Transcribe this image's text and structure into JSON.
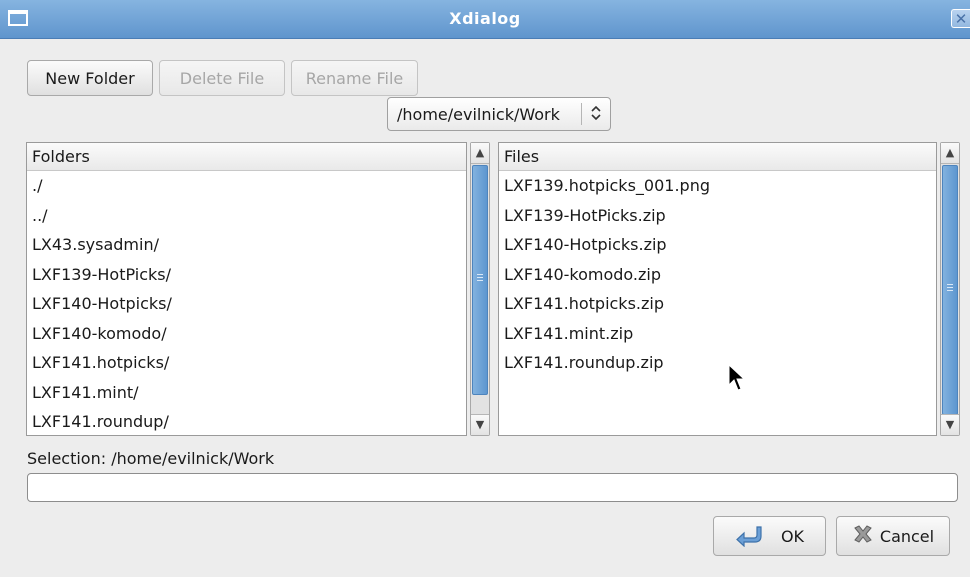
{
  "window": {
    "title": "Xdialog"
  },
  "toolbar": {
    "new_folder": "New Folder",
    "delete_file": "Delete File",
    "rename_file": "Rename File"
  },
  "path_combo": {
    "value": "/home/evilnick/Work"
  },
  "folders": {
    "header": "Folders",
    "items": [
      "./",
      "../",
      "LX43.sysadmin/",
      "LXF139-HotPicks/",
      "LXF140-Hotpicks/",
      "LXF140-komodo/",
      "LXF141.hotpicks/",
      "LXF141.mint/",
      "LXF141.roundup/"
    ]
  },
  "files": {
    "header": "Files",
    "items": [
      "LXF139.hotpicks_001.png",
      "LXF139-HotPicks.zip",
      "LXF140-Hotpicks.zip",
      "LXF140-komodo.zip",
      "LXF141.hotpicks.zip",
      "LXF141.mint.zip",
      "LXF141.roundup.zip"
    ]
  },
  "selection": {
    "label": "Selection: /home/evilnick/Work",
    "value": ""
  },
  "buttons": {
    "ok": "OK",
    "cancel": "Cancel"
  },
  "icons": {
    "window": "window-icon",
    "close": "close-icon",
    "combo": "chevron-up-down-icon",
    "ok": "return-arrow-icon",
    "cancel": "cross-icon"
  },
  "colors": {
    "titlebar": "#6fa2d7",
    "scroll_thumb": "#6fa2d7",
    "background": "#ededed"
  }
}
